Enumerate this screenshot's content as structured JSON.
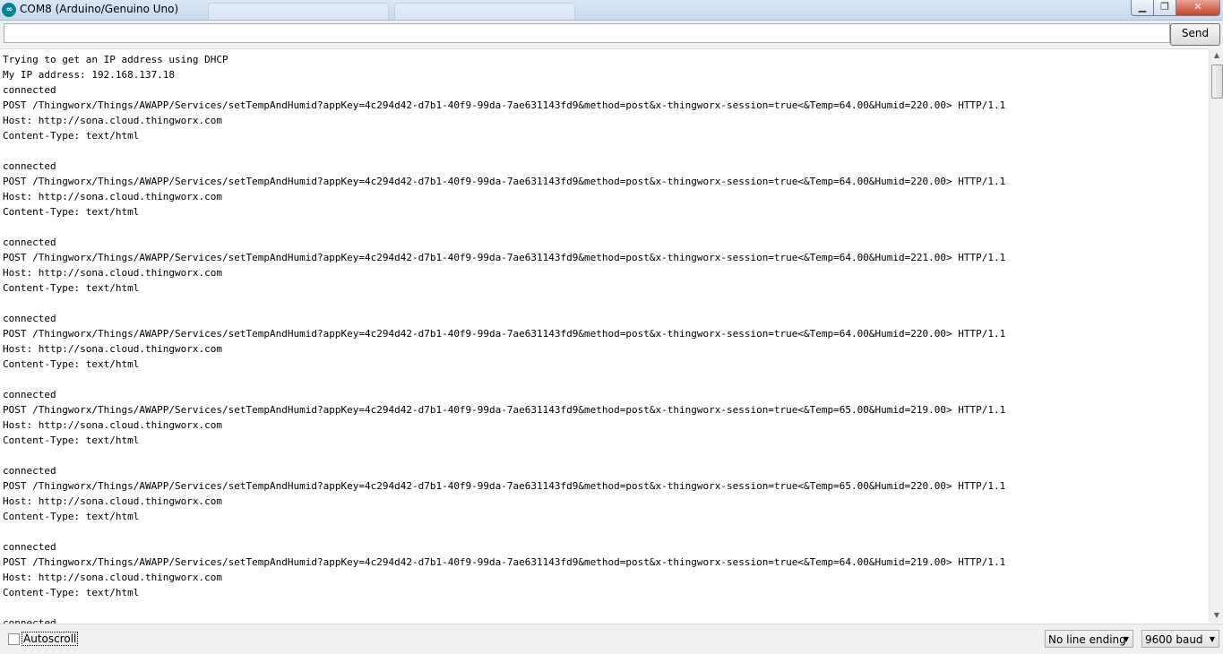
{
  "window": {
    "title": "COM8 (Arduino/Genuino Uno)",
    "app_icon": "arduino-icon",
    "app_icon_text": "∞"
  },
  "window_controls": {
    "minimize_glyph": "▁",
    "maximize_glyph": "❐",
    "close_glyph": "✕"
  },
  "toolbar": {
    "input_value": "",
    "send_label": "Send"
  },
  "output": {
    "lines": [
      "Trying to get an IP address using DHCP",
      "My IP address: 192.168.137.18",
      "connected",
      "POST /Thingworx/Things/AWAPP/Services/setTempAndHumid?appKey=4c294d42-d7b1-40f9-99da-7ae631143fd9&method=post&x-thingworx-session=true<&Temp=64.00&Humid=220.00> HTTP/1.1",
      "Host: http://sona.cloud.thingworx.com",
      "Content-Type: text/html",
      "",
      "connected",
      "POST /Thingworx/Things/AWAPP/Services/setTempAndHumid?appKey=4c294d42-d7b1-40f9-99da-7ae631143fd9&method=post&x-thingworx-session=true<&Temp=64.00&Humid=220.00> HTTP/1.1",
      "Host: http://sona.cloud.thingworx.com",
      "Content-Type: text/html",
      "",
      "connected",
      "POST /Thingworx/Things/AWAPP/Services/setTempAndHumid?appKey=4c294d42-d7b1-40f9-99da-7ae631143fd9&method=post&x-thingworx-session=true<&Temp=64.00&Humid=221.00> HTTP/1.1",
      "Host: http://sona.cloud.thingworx.com",
      "Content-Type: text/html",
      "",
      "connected",
      "POST /Thingworx/Things/AWAPP/Services/setTempAndHumid?appKey=4c294d42-d7b1-40f9-99da-7ae631143fd9&method=post&x-thingworx-session=true<&Temp=64.00&Humid=220.00> HTTP/1.1",
      "Host: http://sona.cloud.thingworx.com",
      "Content-Type: text/html",
      "",
      "connected",
      "POST /Thingworx/Things/AWAPP/Services/setTempAndHumid?appKey=4c294d42-d7b1-40f9-99da-7ae631143fd9&method=post&x-thingworx-session=true<&Temp=65.00&Humid=219.00> HTTP/1.1",
      "Host: http://sona.cloud.thingworx.com",
      "Content-Type: text/html",
      "",
      "connected",
      "POST /Thingworx/Things/AWAPP/Services/setTempAndHumid?appKey=4c294d42-d7b1-40f9-99da-7ae631143fd9&method=post&x-thingworx-session=true<&Temp=65.00&Humid=220.00> HTTP/1.1",
      "Host: http://sona.cloud.thingworx.com",
      "Content-Type: text/html",
      "",
      "connected",
      "POST /Thingworx/Things/AWAPP/Services/setTempAndHumid?appKey=4c294d42-d7b1-40f9-99da-7ae631143fd9&method=post&x-thingworx-session=true<&Temp=64.00&Humid=219.00> HTTP/1.1",
      "Host: http://sona.cloud.thingworx.com",
      "Content-Type: text/html",
      "",
      "connected"
    ]
  },
  "scrollbar": {
    "up_glyph": "▲",
    "down_glyph": "▼"
  },
  "bottombar": {
    "autoscroll_label": "Autoscroll",
    "autoscroll_checked": false,
    "line_ending_value": "No line ending",
    "baud_value": "9600 baud",
    "caret_glyph": "▼"
  }
}
